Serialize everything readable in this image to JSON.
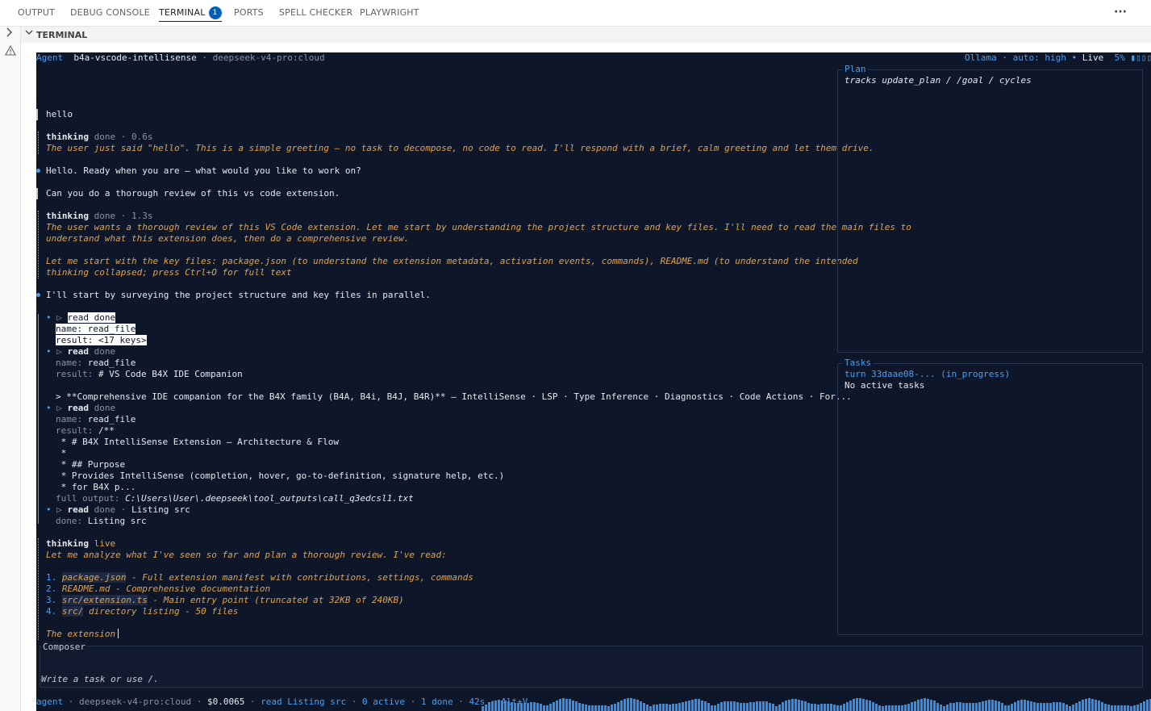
{
  "panel_tabs": [
    {
      "label": "OUTPUT",
      "active": false
    },
    {
      "label": "DEBUG CONSOLE",
      "active": false
    },
    {
      "label": "TERMINAL",
      "active": true,
      "badge": "1"
    },
    {
      "label": "PORTS",
      "active": false
    },
    {
      "label": "SPELL CHECKER",
      "active": false
    },
    {
      "label": "PLAYWRIGHT",
      "active": false
    }
  ],
  "more_actions": "···",
  "section": {
    "title": "TERMINAL"
  },
  "icons": {
    "expand": "chevron-right-icon",
    "collapse": "chevron-down-icon",
    "warning": "warning-icon",
    "more": "more-actions-icon"
  },
  "header": {
    "mode": "Agent",
    "project": "b4a-vscode-intellisense",
    "model": "deepseek-v4-pro:cloud",
    "provider": "Ollama",
    "auto": "auto: high",
    "live": "Live",
    "context": "5%"
  },
  "conversation": {
    "user1": "hello",
    "thinking1": {
      "label": "thinking",
      "status": "done",
      "time": "0.6s",
      "text": "The user just said \"hello\". This is a simple greeting — no task to decompose, no code to read. I'll respond with a brief, calm greeting and let them drive."
    },
    "assistant1": "Hello. Ready when you are — what would you like to work on?",
    "user2": "Can you do a thorough review of this vs code extension.",
    "thinking2": {
      "label": "thinking",
      "status": "done",
      "time": "1.3s",
      "line1": "The user wants a thorough review of this VS Code extension. Let me start by understanding the project structure and key files. I'll need to read the main files to",
      "line2": "understand what this extension does, then do a comprehensive review.",
      "line3": "Let me start with the key files: package.json (to understand the extension metadata, activation events, commands), README.md (to understand the intended",
      "line4": "thinking collapsed; press Ctrl+O for full text"
    },
    "assistant2": "I'll start by surveying the project structure and key files in parallel.",
    "tools": [
      {
        "name": "read",
        "status": "done",
        "lines": [
          {
            "k": "name:",
            "v": "read_file"
          },
          {
            "k": "result:",
            "v": "<17 keys>"
          }
        ]
      },
      {
        "name": "read",
        "status": "done",
        "lines": [
          {
            "k": "name:",
            "v": "read_file"
          },
          {
            "k": "result:",
            "v": "# VS Code B4X IDE Companion"
          },
          {
            "k": "",
            "v": ""
          },
          {
            "k": "",
            "v": "> **Comprehensive IDE companion for the B4X family (B4A, B4i, B4J, B4R)** — IntelliSense · LSP · Type Inference · Diagnostics · Code Actions · For..."
          }
        ]
      },
      {
        "name": "read",
        "status": "done",
        "lines": [
          {
            "k": "name:",
            "v": "read_file"
          },
          {
            "k": "result:",
            "v": "/**"
          },
          {
            "k": "",
            "v": " * # B4X IntelliSense Extension — Architecture & Flow"
          },
          {
            "k": "",
            "v": " *"
          },
          {
            "k": "",
            "v": " * ## Purpose"
          },
          {
            "k": "",
            "v": " * Provides IntelliSense (completion, hover, go-to-definition, signature help, etc.)"
          },
          {
            "k": "",
            "v": " * for B4X p..."
          },
          {
            "k": "full output:",
            "v": "C:\\Users\\User\\.deepseek\\tool_outputs\\call_q3edcsl1.txt"
          }
        ]
      },
      {
        "name": "read",
        "status": "done",
        "extra": "Listing src",
        "lines": [
          {
            "k": "done:",
            "v": "Listing src"
          }
        ]
      }
    ],
    "thinking3": {
      "label": "thinking",
      "status": "live",
      "intro": "Let me analyze what I've seen so far and plan a thorough review. I've read:",
      "items": [
        {
          "n": "1.",
          "file": "package.json",
          "desc": " - Full extension manifest with contributions, settings, commands"
        },
        {
          "n": "2.",
          "file": "README.md",
          "desc": " - Comprehensive documentation"
        },
        {
          "n": "3.",
          "file": "src/extension.ts",
          "desc": " - Main entry point (truncated at 32KB of 240KB)"
        },
        {
          "n": "4.",
          "file": "src/",
          "desc": " directory listing - 50 files"
        }
      ],
      "partial": "The extension"
    }
  },
  "plan": {
    "title": "Plan",
    "text": "tracks update_plan / /goal / cycles"
  },
  "tasks": {
    "title": "Tasks",
    "turn": "turn 33daae08-... (in_progress)",
    "none": "No active tasks"
  },
  "composer": {
    "title": "Composer",
    "placeholder": "Write a task or use /."
  },
  "footer": {
    "mode": "agent",
    "model": "deepseek-v4-pro:cloud",
    "cost": "$0.0065",
    "activity": "read Listing src",
    "active": "0 active",
    "done": "1 done",
    "elapsed": "42s",
    "shortcut": "Alt+V"
  },
  "colors": {
    "terminal_bg": "#0e1629",
    "accent": "#4aa0f0",
    "thinking": "#e0a452",
    "muted": "#8a93a6",
    "tab_badge": "#005fb8"
  }
}
